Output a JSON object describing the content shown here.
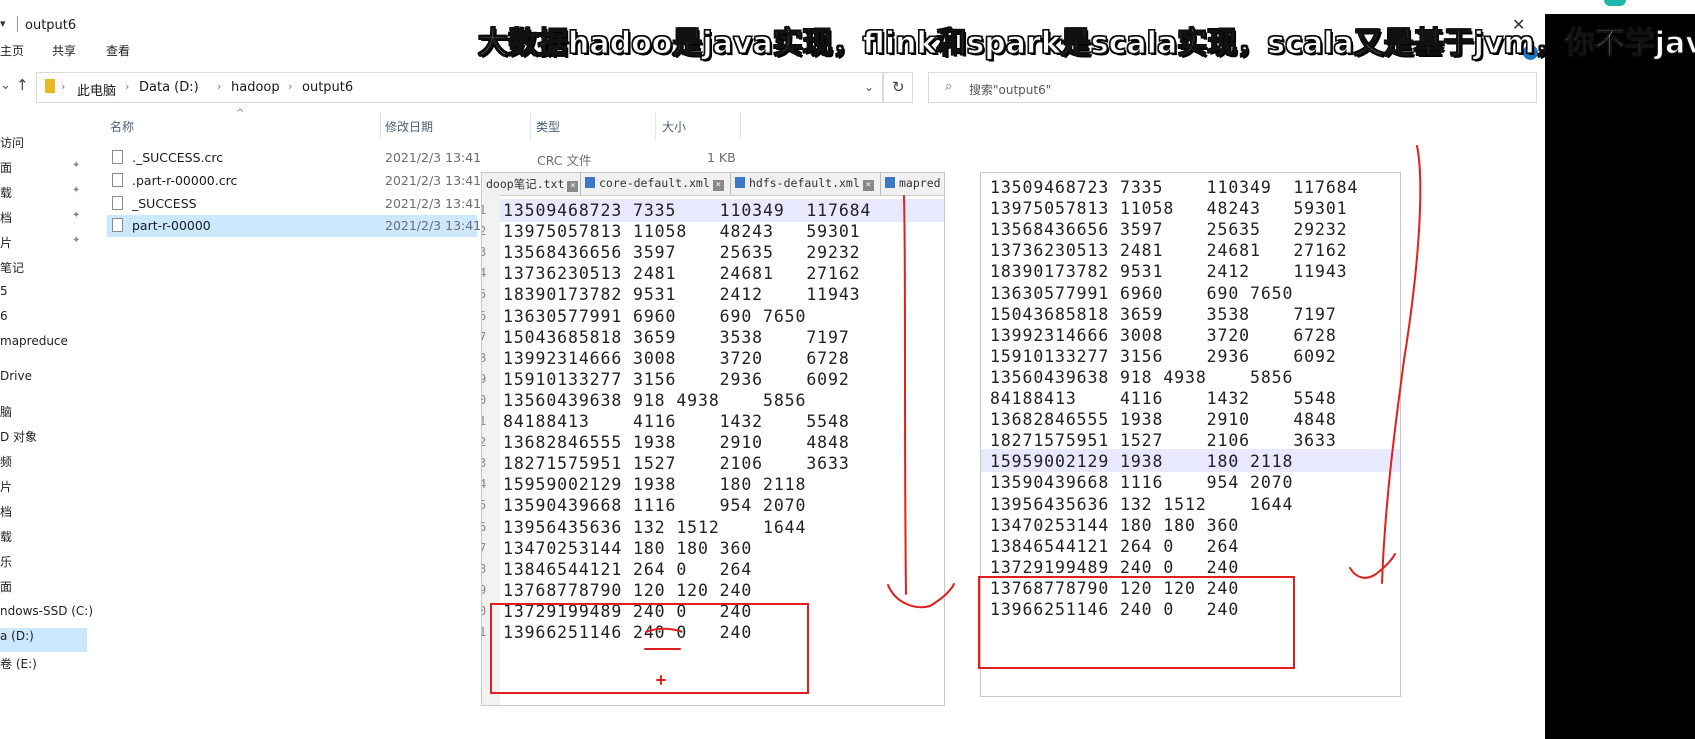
{
  "window": {
    "title": "output6",
    "close_glyph": "✕",
    "help_glyph": "?"
  },
  "ribbon": {
    "tabs": [
      "主页",
      "共享",
      "查看"
    ]
  },
  "address": {
    "crumbs": [
      "此电脑",
      "Data (D:)",
      "hadoop",
      "output6"
    ],
    "search_placeholder": "搜索\"output6\""
  },
  "sidebar": {
    "items": [
      "访问",
      "面",
      "载",
      "档",
      "片",
      "笔记",
      "5",
      "6",
      "mapreduce",
      "Drive",
      "脑",
      "D 对象",
      "频",
      "片",
      "档",
      "载",
      "乐",
      "面",
      "ndows-SSD (C:)",
      "a (D:)",
      "卷 (E:)"
    ]
  },
  "columns": {
    "name": "名称",
    "date": "修改日期",
    "type": "类型",
    "size": "大小"
  },
  "files": [
    {
      "name": "._SUCCESS.crc",
      "date": "2021/2/3 13:41",
      "type": "CRC 文件",
      "size": "1 KB",
      "selected": false
    },
    {
      "name": ".part-r-00000.crc",
      "date": "2021/2/3 13:41",
      "type": "",
      "size": "",
      "selected": false
    },
    {
      "name": "_SUCCESS",
      "date": "2021/2/3 13:41",
      "type": "",
      "size": "",
      "selected": false
    },
    {
      "name": "part-r-00000",
      "date": "2021/2/3 13:41",
      "type": "",
      "size": "",
      "selected": true
    }
  ],
  "editor_left": {
    "tabs": [
      "doop笔记.txt",
      "core-default.xml",
      "hdfs-default.xml",
      "mapred"
    ],
    "lines": [
      "13509468723 7335    110349  117684",
      "13975057813 11058   48243   59301",
      "13568436656 3597    25635   29232",
      "13736230513 2481    24681   27162",
      "18390173782 9531    2412    11943",
      "13630577991 6960    690 7650",
      "15043685818 3659    3538    7197",
      "13992314666 3008    3720    6728",
      "15910133277 3156    2936    6092",
      "13560439638 918 4938    5856",
      "84188413    4116    1432    5548",
      "13682846555 1938    2910    4848",
      "18271575951 1527    2106    3633",
      "15959002129 1938    180 2118",
      "13590439668 1116    954 2070",
      "13956435636 132 1512    1644",
      "13470253144 180 180 360",
      "13846544121 264 0   264",
      "13768778790 120 120 240",
      "13729199489 240 0   240",
      "13966251146 240 0   240"
    ],
    "line_numbers": [
      "1",
      "2",
      "3",
      "4",
      "5",
      "6",
      "7",
      "8",
      "9",
      "0",
      "1",
      "2",
      "3",
      "4",
      "5",
      "6",
      "7",
      "8",
      "9",
      "0",
      "1"
    ]
  },
  "editor_right": {
    "lines": [
      "13509468723 7335    110349  117684",
      "13975057813 11058   48243   59301",
      "13568436656 3597    25635   29232",
      "13736230513 2481    24681   27162",
      "18390173782 9531    2412    11943",
      "13630577991 6960    690 7650",
      "15043685818 3659    3538    7197",
      "13992314666 3008    3720    6728",
      "15910133277 3156    2936    6092",
      "13560439638 918 4938    5856",
      "84188413    4116    1432    5548",
      "13682846555 1938    2910    4848",
      "18271575951 1527    2106    3633",
      "15959002129 1938    180 2118",
      "13590439668 1116    954 2070",
      "13956435636 132 1512    1644",
      "13470253144 180 180 360",
      "13846544121 264 0   264",
      "13729199489 240 0   240",
      "13768778790 120 120 240",
      "13966251146 240 0   240"
    ]
  },
  "subtitle": "大数据hadoo是java实现，flink和spark是scala实现，scala又是基于jvm，你不学java",
  "colors": {
    "annotation": "#e0201c",
    "selection": "#cce8ff",
    "editor_highlight": "#e8e8ff"
  }
}
